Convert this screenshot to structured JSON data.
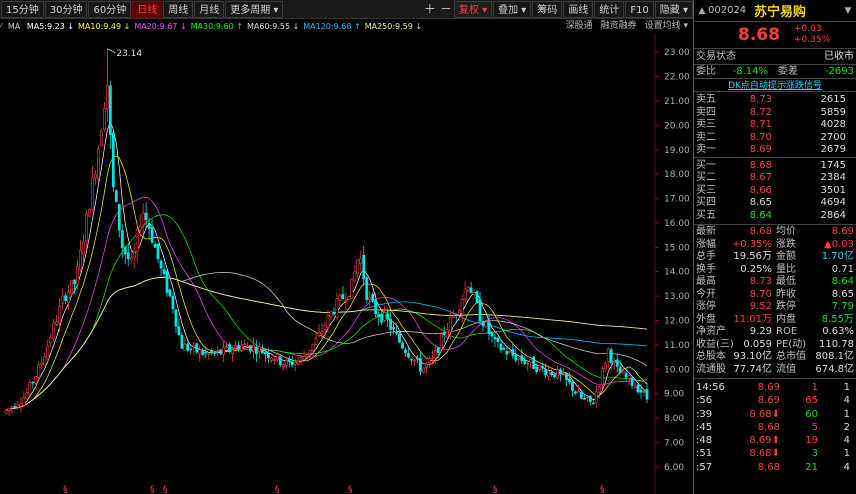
{
  "toolbar": {
    "periods": [
      "15分钟",
      "30分钟",
      "60分钟",
      "日线",
      "周线",
      "月线",
      "更多周期 ▾"
    ],
    "active_period": "日线",
    "fuquan": "复权 ▾",
    "overlay": "叠加 ▾",
    "chips": "筹码",
    "draw": "画线",
    "stats": "统计",
    "f10": "F10",
    "hide": "隐藏 ▾"
  },
  "ma_line": {
    "ma": "MA",
    "items": [
      {
        "label": "MA5:9.23",
        "color": "#ffffff",
        "arrow": "↓"
      },
      {
        "label": "MA10:9.49",
        "color": "#ffff00",
        "arrow": "↓"
      },
      {
        "label": "MA20:9.67",
        "color": "#ff44ff",
        "arrow": "↓"
      },
      {
        "label": "MA30:9.60",
        "color": "#00ff00",
        "arrow": "↑"
      },
      {
        "label": "MA60:9.55",
        "color": "#dcdcdc",
        "arrow": "↓"
      },
      {
        "label": "MA120:9.68",
        "color": "#00bfff",
        "arrow": "↑"
      },
      {
        "label": "MA250:9.59",
        "color": "#f0e68c",
        "arrow": "↓"
      }
    ]
  },
  "rightlinks": [
    "深股通",
    "融资融券",
    "设置均线 ▾"
  ],
  "chart_data": {
    "type": "candlestick",
    "max_label": "23.14",
    "yticks": [
      "23.00",
      "22.00",
      "21.00",
      "20.00",
      "19.00",
      "18.00",
      "17.00",
      "16.00",
      "15.00",
      "14.00",
      "13.00",
      "12.00",
      "11.00",
      "10.00",
      "9.00",
      "8.00",
      "7.00",
      "6.00"
    ],
    "ymin": 5.5,
    "ymax": 23.5,
    "marker": "§"
  },
  "stock": {
    "code": "002024",
    "name": "苏宁易购",
    "price": "8.68",
    "change": "+0.03",
    "pct": "+0.35%"
  },
  "status": {
    "label": "交易状态",
    "value": "已收市"
  },
  "weibi": {
    "label": "委比",
    "value": "-8.14%",
    "label2": "委差",
    "value2": "-2693"
  },
  "ddx_link": "DK点自动提示涨跌信号",
  "asks": [
    {
      "label": "卖五",
      "price": "8.73",
      "vol": "2615"
    },
    {
      "label": "卖四",
      "price": "8.72",
      "vol": "5859"
    },
    {
      "label": "卖三",
      "price": "8.71",
      "vol": "4028"
    },
    {
      "label": "卖二",
      "price": "8.70",
      "vol": "2700"
    },
    {
      "label": "卖一",
      "price": "8.69",
      "vol": "2679"
    }
  ],
  "bids": [
    {
      "label": "买一",
      "price": "8.68",
      "vol": "1745"
    },
    {
      "label": "买二",
      "price": "8.67",
      "vol": "2384"
    },
    {
      "label": "买三",
      "price": "8.66",
      "vol": "3501"
    },
    {
      "label": "买四",
      "price": "8.65",
      "vol": "4694"
    },
    {
      "label": "买五",
      "price": "8.64",
      "vol": "2864"
    }
  ],
  "stats": [
    {
      "l1": "最新",
      "v1": "8.68",
      "c1": "red",
      "l2": "均价",
      "v2": "8.69",
      "c2": "red"
    },
    {
      "l1": "涨幅",
      "v1": "+0.35%",
      "c1": "red",
      "l2": "涨跌",
      "v2": "▲0.03",
      "c2": "red"
    },
    {
      "l1": "总手",
      "v1": "19.56万",
      "c1": "wht",
      "l2": "金额",
      "v2": "1.70亿",
      "c2": "cyan"
    },
    {
      "l1": "换手",
      "v1": "0.25%",
      "c1": "wht",
      "l2": "量比",
      "v2": "0.71",
      "c2": "wht"
    },
    {
      "l1": "最高",
      "v1": "8.73",
      "c1": "red",
      "l2": "最低",
      "v2": "8.64",
      "c2": "green"
    },
    {
      "l1": "今开",
      "v1": "8.70",
      "c1": "red",
      "l2": "昨收",
      "v2": "8.65",
      "c2": "wht"
    },
    {
      "l1": "涨停",
      "v1": "9.52",
      "c1": "red",
      "l2": "跌停",
      "v2": "7.79",
      "c2": "green"
    },
    {
      "l1": "外盘",
      "v1": "11.01万",
      "c1": "red",
      "l2": "内盘",
      "v2": "8.55万",
      "c2": "green"
    },
    {
      "l1": "净资产",
      "v1": "9.29",
      "c1": "wht",
      "l2": "ROE",
      "v2": "0.63%",
      "c2": "wht"
    },
    {
      "l1": "收益(三)",
      "v1": "0.059",
      "c1": "wht",
      "l2": "PE(动)",
      "v2": "110.78",
      "c2": "wht"
    },
    {
      "l1": "总股本",
      "v1": "93.10亿",
      "c1": "wht",
      "l2": "总市值",
      "v2": "808.1亿",
      "c2": "wht"
    },
    {
      "l1": "流通股",
      "v1": "77.74亿",
      "c1": "wht",
      "l2": "流值",
      "v2": "674.8亿",
      "c2": "wht"
    }
  ],
  "ticks": [
    {
      "time": "14:56",
      "price": "8.69",
      "pc": "red",
      "vol": "1",
      "vc": "red",
      "flag": "1"
    },
    {
      "time": ":56",
      "price": "8.69",
      "pc": "red",
      "vol": "65",
      "vc": "red",
      "flag": "4"
    },
    {
      "time": ":39",
      "price": "8.68⬇",
      "pc": "red",
      "vol": "60",
      "vc": "green",
      "flag": "1"
    },
    {
      "time": ":45",
      "price": "8.68",
      "pc": "red",
      "vol": "5",
      "vc": "red",
      "flag": "2"
    },
    {
      "time": ":48",
      "price": "8.69⬆",
      "pc": "red",
      "vol": "19",
      "vc": "red",
      "flag": "4"
    },
    {
      "time": ":51",
      "price": "8.68⬇",
      "pc": "red",
      "vol": "3",
      "vc": "green",
      "flag": "1"
    },
    {
      "time": ":57",
      "price": "8.68",
      "pc": "red",
      "vol": "21",
      "vc": "green",
      "flag": "4"
    }
  ]
}
